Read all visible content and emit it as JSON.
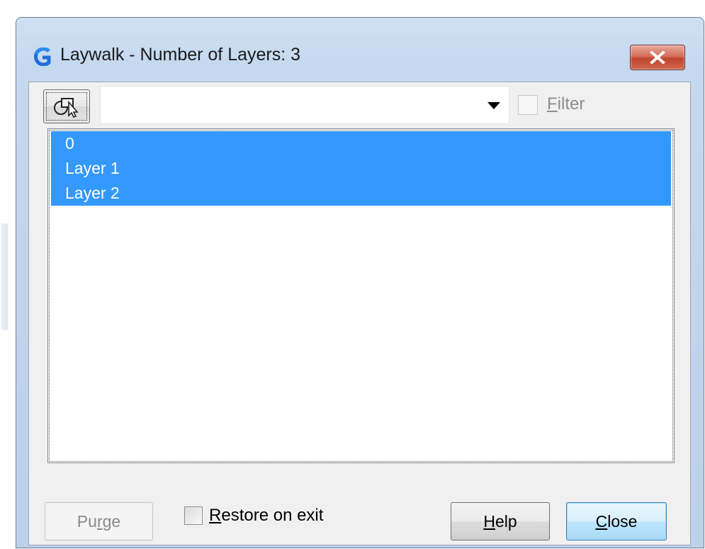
{
  "window": {
    "title": "Laywalk - Number of Layers: 3",
    "close_glyph": "X"
  },
  "toolbar": {
    "layer_combo_value": "",
    "filter_label_mnemonic": "F",
    "filter_label_rest": "ilter",
    "filter_checked": false
  },
  "layers": {
    "items": [
      {
        "name": "0",
        "selected": true
      },
      {
        "name": "Layer 1",
        "selected": true
      },
      {
        "name": "Layer 2",
        "selected": true
      }
    ]
  },
  "footer": {
    "purge_label_pre": "Pu",
    "purge_label_mnemonic": "r",
    "purge_label_post": "ge",
    "restore_mnemonic": "R",
    "restore_rest": "estore on exit",
    "restore_checked": false,
    "help_mnemonic": "H",
    "help_rest": "elp",
    "close_mnemonic": "C",
    "close_rest": "lose"
  },
  "colors": {
    "selection": "#3399ff",
    "close_button_red": "#c0442c",
    "frame_blue": "#c4d8ee"
  },
  "icons": {
    "app": "gstarcad-logo-icon",
    "pick": "select-objects-icon",
    "window_close": "close-icon",
    "dropdown": "chevron-down-icon"
  }
}
